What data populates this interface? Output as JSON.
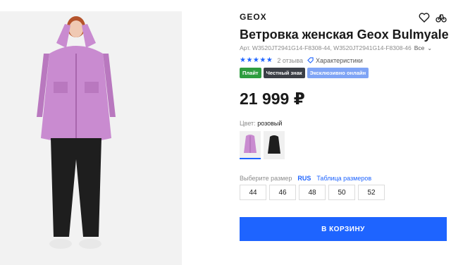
{
  "product": {
    "brand": "GEOX",
    "title": "Ветровка женская Geox Bulmyale",
    "article_text": "Арт. W3520JT2941G14-F8308-44, W3520JT2941G14-F8308-46",
    "article_more": "Все",
    "reviews_text": "2 отзыва",
    "characteristics_label": "Характеристики",
    "badges": [
      {
        "label": "Плайт",
        "color": "#2e9d3f"
      },
      {
        "label": "Честный знак",
        "color": "#3b3f46"
      },
      {
        "label": "Эксклюзивно онлайн",
        "color": "#7fa4f5"
      }
    ],
    "price": "21 999 ₽",
    "color_label": "Цвет:",
    "color_value": "розовый",
    "size_label": "Выберите размер",
    "size_system": "RUS",
    "size_table_link": "Таблица размеров",
    "sizes": [
      "44",
      "46",
      "48",
      "50",
      "52"
    ],
    "cart_button": "В КОРЗИНУ"
  },
  "icons": {
    "wishlist": "heart-icon",
    "compare": "compare-icon",
    "characteristics": "tag-icon"
  },
  "colors": {
    "accent": "#1e64ff",
    "jacket_pink": "#c98bd0"
  }
}
